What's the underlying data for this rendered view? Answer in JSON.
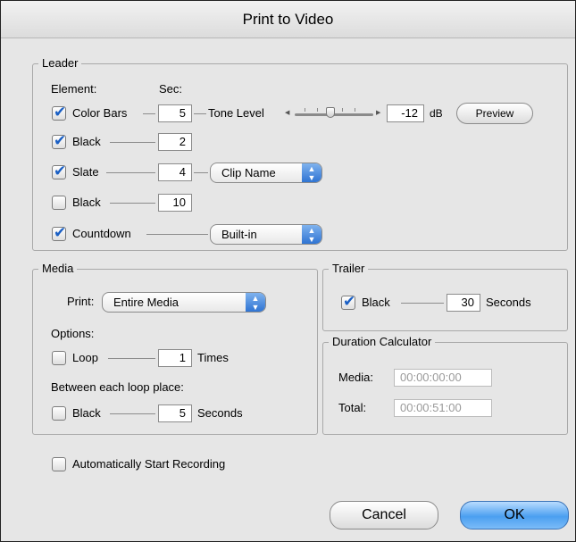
{
  "window": {
    "title": "Print to Video"
  },
  "leader": {
    "title": "Leader",
    "element_header": "Element:",
    "sec_header": "Sec:",
    "color_bars": {
      "label": "Color Bars",
      "checked": true,
      "sec": "5"
    },
    "tone_level": {
      "label": "Tone Level",
      "value": "-12",
      "unit": "dB"
    },
    "preview_label": "Preview",
    "black1": {
      "label": "Black",
      "checked": true,
      "sec": "2"
    },
    "slate": {
      "label": "Slate",
      "checked": true,
      "sec": "4",
      "source": "Clip Name"
    },
    "black2": {
      "label": "Black",
      "checked": false,
      "sec": "10"
    },
    "countdown": {
      "label": "Countdown",
      "checked": true,
      "type": "Built-in"
    }
  },
  "media": {
    "title": "Media",
    "print_label": "Print:",
    "print_value": "Entire Media",
    "options_label": "Options:",
    "loop": {
      "label": "Loop",
      "checked": false,
      "value": "1",
      "unit": "Times"
    },
    "between_label": "Between each loop place:",
    "black": {
      "label": "Black",
      "checked": false,
      "value": "5",
      "unit": "Seconds"
    }
  },
  "trailer": {
    "title": "Trailer",
    "black": {
      "label": "Black",
      "checked": true,
      "value": "30",
      "unit": "Seconds"
    }
  },
  "duration": {
    "title": "Duration Calculator",
    "media_label": "Media:",
    "media_value": "00:00:00:00",
    "total_label": "Total:",
    "total_value": "00:00:51:00"
  },
  "auto_record": {
    "label": "Automatically Start Recording",
    "checked": false
  },
  "buttons": {
    "cancel": "Cancel",
    "ok": "OK"
  },
  "colors": {
    "accent": "#4b9ff0",
    "check": "#1a5fc4"
  }
}
